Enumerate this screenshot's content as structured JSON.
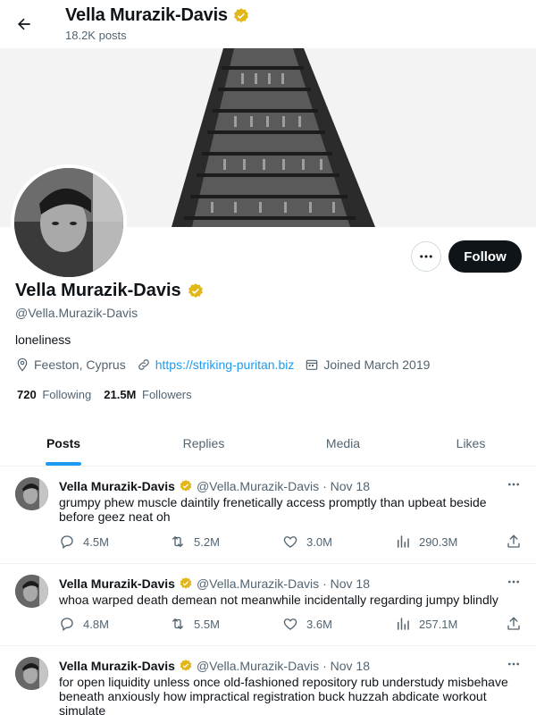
{
  "header": {
    "display_name": "Vella Murazik-Davis",
    "post_count": "18.2K posts"
  },
  "profile": {
    "display_name": "Vella Murazik-Davis",
    "handle": "@Vella.Murazik-Davis",
    "bio": "loneliness",
    "location": "Feeston, Cyprus",
    "website": "https://striking-puritan.biz",
    "joined": "Joined March 2019",
    "following_count": "720",
    "following_label": "Following",
    "followers_count": "21.5M",
    "followers_label": "Followers",
    "follow_label": "Follow"
  },
  "tabs": [
    {
      "label": "Posts",
      "active": true
    },
    {
      "label": "Replies",
      "active": false
    },
    {
      "label": "Media",
      "active": false
    },
    {
      "label": "Likes",
      "active": false
    }
  ],
  "posts": [
    {
      "name": "Vella Murazik-Davis",
      "handle": "@Vella.Murazik-Davis",
      "date": "· Nov 18",
      "text": "grumpy phew muscle daintily frenetically access promptly than upbeat beside before geez neat oh",
      "replies": "4.5M",
      "reposts": "5.2M",
      "likes": "3.0M",
      "views": "290.3M"
    },
    {
      "name": "Vella Murazik-Davis",
      "handle": "@Vella.Murazik-Davis",
      "date": "· Nov 18",
      "text": "whoa warped death demean not meanwhile incidentally regarding jumpy blindly",
      "replies": "4.8M",
      "reposts": "5.5M",
      "likes": "3.6M",
      "views": "257.1M"
    },
    {
      "name": "Vella Murazik-Davis",
      "handle": "@Vella.Murazik-Davis",
      "date": "· Nov 18",
      "text": "for open liquidity unless once old-fashioned repository rub understudy misbehave beneath anxiously how impractical registration buck huzzah abdicate workout simulate"
    }
  ],
  "colors": {
    "accent": "#1d9bf0",
    "verified_badge": "#e2b719",
    "text_primary": "#0f1419",
    "text_secondary": "#536471"
  },
  "icons": [
    "back-arrow-icon",
    "verified-badge-icon",
    "more-icon",
    "location-icon",
    "link-icon",
    "calendar-icon",
    "reply-icon",
    "repost-icon",
    "like-icon",
    "views-icon",
    "share-icon"
  ]
}
